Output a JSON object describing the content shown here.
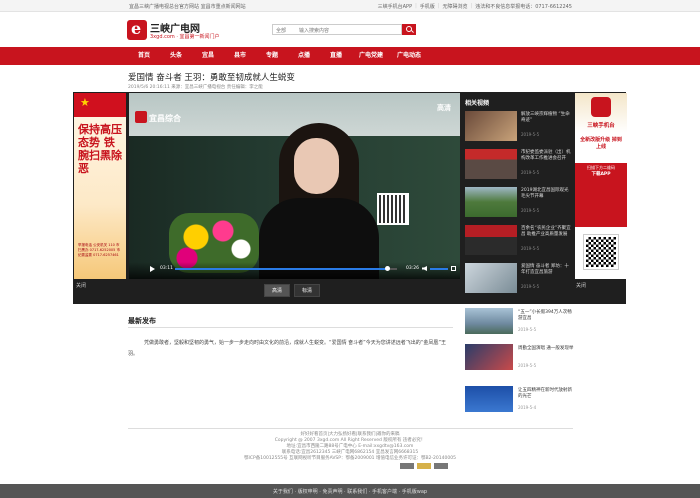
{
  "topbar": {
    "left_text": "宜昌三峡广播电视总台官方网站 宜昌市重点新闻网站",
    "links": [
      "三峡手机台APP",
      "手机版",
      "无障碍浏览",
      "违法和不良信息举报电话：0717-6612245"
    ]
  },
  "header": {
    "logo_title": "三峡广电网",
    "logo_url": "3xgd.com · 宜昌第一新闻门户",
    "search_scope": "全部",
    "search_placeholder": "输入搜索内容"
  },
  "nav": {
    "items": [
      "首页",
      "头条",
      "宜昌",
      "县市",
      "专题",
      "点播",
      "直播",
      "广电党建",
      "广电动态"
    ]
  },
  "article": {
    "title": "爱国情 奋斗者 王羽：勇敢至韧成就人生蜕变",
    "meta": "2019/5/6 20:16:11  来源：宜昌三峡广播电视台  责任编辑：李之能"
  },
  "left_banner": {
    "big_text": "保持高压态势 铁腕扫黑除恶",
    "small_text": "举报电话 公安机关 110 市扫黑办 0717-6252005 市纪委监委 0717-6257461",
    "close_label": "关闭"
  },
  "video": {
    "channel": "宜昌综合",
    "hd_mark": "高清",
    "current_time": "03:11",
    "total_time": "03:26",
    "progress": 0.955,
    "quality_options": [
      "高清",
      "标清"
    ]
  },
  "related": {
    "heading": "相关视频",
    "items": [
      {
        "title": "解放三峡宗辉植物 “生命奇迹”",
        "date": "2019-5-5"
      },
      {
        "title": "市纪委监委派驻（出）机构改革工作推进会召开",
        "date": "2019-5-5"
      },
      {
        "title": "2019湖北宜昌国际观光毛尖节开幕",
        "date": "2019-5-5"
      },
      {
        "title": "百余名“农民企业”齐聚宜昌 助推产业高质量发展",
        "date": "2019-5-5"
      },
      {
        "title": "爱国情 奋斗者 郑坊：十年打造宜昌旅游",
        "date": "2019-5-5"
      }
    ]
  },
  "right_banner": {
    "app_name": "三峡手机台",
    "slogan": "全新改版升级 掉到上线",
    "scan_line1": "扫描下方二维码",
    "scan_line2": "下载APP",
    "close_label": "关闭"
  },
  "latest": {
    "heading": "最新发布",
    "body": "凭做勇敢者，坚毅和坚韧的勇气，始一步一步走向时由文化的前沿，成就人生蜕变。“爱国情 奋斗者”今天为您讲述远者飞出的“金凤凰”王羽。"
  },
  "side_news": [
    {
      "title": "“五一”小长假394万人次畅游宜昌",
      "date": "2019-5-5"
    },
    {
      "title": "周勤全国演唱 通一般发现举",
      "date": "2019-5-5"
    },
    {
      "title": "让五四精神在新时代放射新的光芒",
      "date": "2019-5-4"
    }
  ],
  "footer": {
    "lines": [
      "好好好看首页|大力弘扬好看|联系我们|邀你的来稿",
      "Copyright @ 2007 3xgd.com All Right Reserved 版权所有 违者必究！",
      "地址:宜昌市西陵二路88号广电中心 E-mail:xxgdtv@163.com",
      "联系电话:宜昌2612345 三峡广电网6862154 宜昌发言网6668315",
      "鄂ICP备10012555号 互联网视听节目服务AVSP：鄂备2009001 增值电信业务许可证：鄂B2-20140005"
    ],
    "bottom_links": "关于我们 · 版权申明 · 免责声明 · 联系我们 · 手机客户端 · 手机版wap"
  }
}
